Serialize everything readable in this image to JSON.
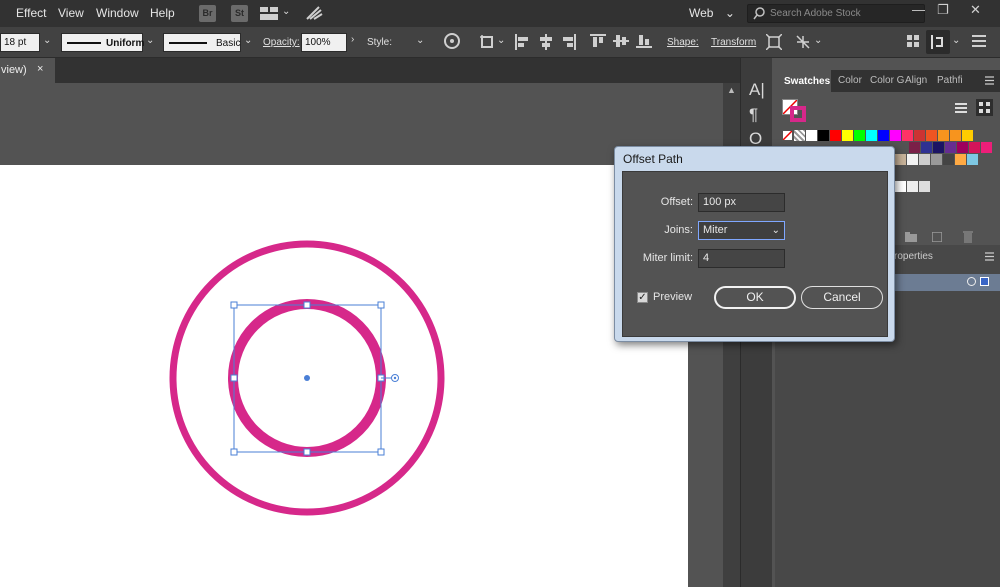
{
  "menu": {
    "items": [
      "Effect",
      "View",
      "Window",
      "Help"
    ],
    "app_buttons": [
      "Br",
      "St"
    ],
    "workspace": "Web",
    "search_placeholder": "Search Adobe Stock"
  },
  "control_bar": {
    "stroke_weight": "18 pt",
    "profile": "Uniform",
    "brush": "Basic",
    "opacity_label": "Opacity:",
    "opacity_value": "100%",
    "style_label": "Style:",
    "shape_label": "Shape:",
    "transform_label": "Transform"
  },
  "document_tab": {
    "title": "view)",
    "close": "×"
  },
  "swatches_panel": {
    "tabs": [
      "Swatches",
      "Color",
      "Color G",
      "Align",
      "Pathfi"
    ],
    "active_tab": "Swatches",
    "colors": {
      "row1": [
        "#ffffff",
        "#000000",
        "#ff0000",
        "#ffff00",
        "#00ff00",
        "#00ffff",
        "#0000ff",
        "#ff00ff",
        "#ff3366",
        "#cc3333",
        "#ee5522",
        "#f7941e",
        "#f7941e",
        "#ffcc00"
      ],
      "row2": [
        "#7a2048",
        "#2e3192",
        "#1b1464",
        "#662d91",
        "#9e005d",
        "#d4145a",
        "#ed1e79"
      ],
      "row3": [
        "#c7b299",
        "#f2f2f2",
        "#cccccc",
        "#999999",
        "#444444",
        "#ffaa44",
        "#7ec8e3"
      ],
      "row4": [
        "#ffffff",
        "#eeeeee",
        "#dddddd"
      ]
    }
  },
  "lower_panel": {
    "tab_label": "roperties"
  },
  "dialog": {
    "title": "Offset Path",
    "offset_label": "Offset:",
    "offset_value": "100 px",
    "joins_label": "Joins:",
    "joins_value": "Miter",
    "miter_label": "Miter limit:",
    "miter_value": "4",
    "preview_label": "Preview",
    "preview_checked": true,
    "ok_label": "OK",
    "cancel_label": "Cancel"
  },
  "artwork": {
    "stroke_color": "#d6288a",
    "selection_color": "#4a7fd6"
  }
}
